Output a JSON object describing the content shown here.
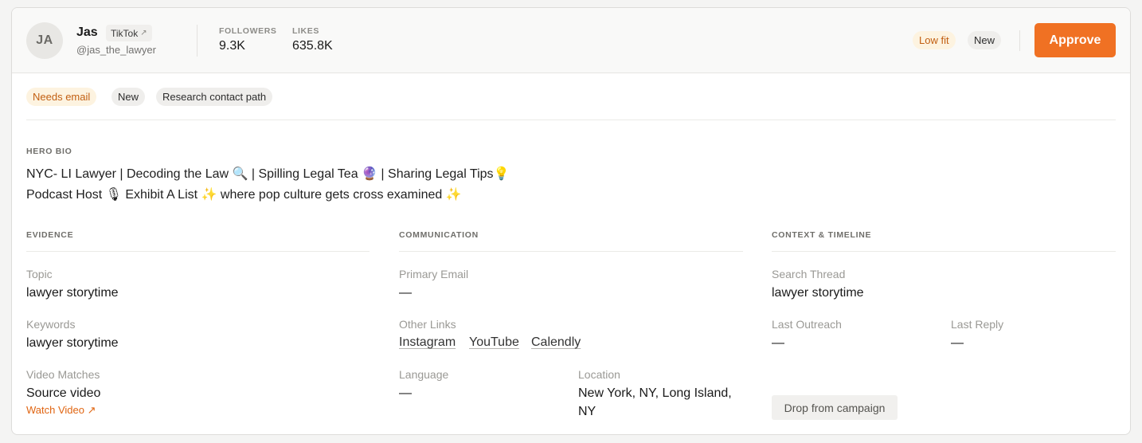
{
  "creator": {
    "initials": "JA",
    "name": "Jas",
    "platform": "TikTok",
    "platform_icon": "external-link-arrow",
    "handle": "@jas_the_lawyer"
  },
  "stats": {
    "followers_label": "FOLLOWERS",
    "followers_value": "9.3K",
    "likes_label": "LIKES",
    "likes_value": "635.8K"
  },
  "header_badges": {
    "fit": "Low fit",
    "status": "New",
    "approve_label": "Approve"
  },
  "tags": [
    "Needs email",
    "New",
    "Research contact path"
  ],
  "bio": {
    "label": "HERO BIO",
    "line1": "NYC- LI Lawyer | Decoding the Law 🔍 | Spilling Legal Tea 🔮 | Sharing Legal Tips💡",
    "line2": "Podcast Host 🎙 Exhibit A List ✨ where pop culture gets cross examined ✨"
  },
  "evidence": {
    "label": "EVIDENCE",
    "topic_label": "Topic",
    "topic_value": "lawyer storytime",
    "keywords_label": "Keywords",
    "keywords_value": "lawyer storytime",
    "video_label": "Video Matches",
    "video_value": "Source video",
    "watch_link": "Watch Video ↗"
  },
  "communication": {
    "label": "COMMUNICATION",
    "email_label": "Primary Email",
    "email_value": "—",
    "other_links_label": "Other Links",
    "other_links": [
      "Instagram",
      "YouTube",
      "Calendly"
    ],
    "language_label": "Language",
    "language_value": "—",
    "location_label": "Location",
    "location_value": "New York, NY, Long Island, NY"
  },
  "context": {
    "label": "CONTEXT & TIMELINE",
    "search_thread_label": "Search Thread",
    "search_thread_value": "lawyer storytime",
    "last_outreach_label": "Last Outreach",
    "last_outreach_value": "—",
    "last_reply_label": "Last Reply",
    "last_reply_value": "—",
    "drop_label": "Drop from campaign"
  },
  "colors": {
    "accent": "#f07123",
    "warn_bg": "#fdf3e0",
    "warn_text": "#c25f12",
    "link_orange": "#e06512"
  }
}
